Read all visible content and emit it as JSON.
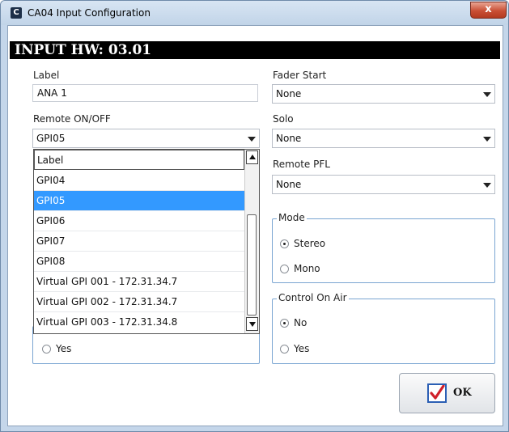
{
  "window": {
    "title": "CA04 Input Configuration",
    "app_icon_letter": "C",
    "close_label": "x"
  },
  "header": {
    "text": "INPUT HW: 03.01"
  },
  "left": {
    "label_caption": "Label",
    "label_value": "ANA 1",
    "remote_caption": "Remote ON/OFF",
    "remote_value": "GPI05",
    "dropdown_items": [
      "Label",
      "GPI04",
      "GPI05",
      "GPI06",
      "GPI07",
      "GPI08",
      "Virtual GPI 001 - 172.31.34.7",
      "Virtual GPI 002 - 172.31.34.7",
      "Virtual GPI 003 - 172.31.34.8"
    ],
    "dropdown_selected": "GPI05",
    "hidden_group_yes": "Yes"
  },
  "right": {
    "fader_caption": "Fader Start",
    "fader_value": "None",
    "solo_caption": "Solo",
    "solo_value": "None",
    "pfl_caption": "Remote PFL",
    "pfl_value": "None",
    "mode": {
      "title": "Mode",
      "options": [
        "Stereo",
        "Mono"
      ],
      "selected": "Stereo"
    },
    "control_on_air": {
      "title": "Control On Air",
      "options": [
        "No",
        "Yes"
      ],
      "selected": "No"
    }
  },
  "ok_button": {
    "label": "OK",
    "icon": "checkbox-check-icon"
  },
  "colors": {
    "selection": "#3399ff",
    "group_border": "#7aa5d2",
    "header_bg": "#000000",
    "check_red": "#d0202a"
  }
}
